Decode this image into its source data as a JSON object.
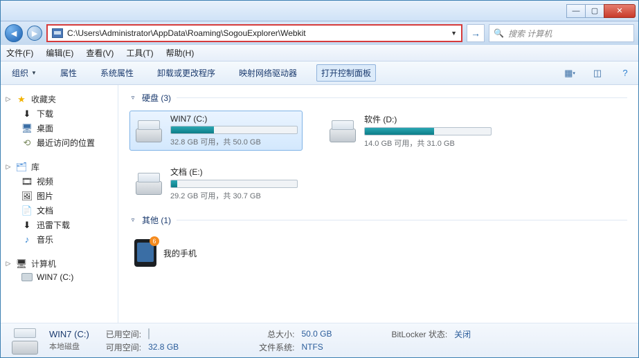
{
  "address_bar": {
    "path": "C:\\Users\\Administrator\\AppData\\Roaming\\SogouExplorer\\Webkit"
  },
  "search": {
    "placeholder": "搜索 计算机"
  },
  "menu": {
    "file": "文件(F)",
    "edit": "编辑(E)",
    "view": "查看(V)",
    "tools": "工具(T)",
    "help": "帮助(H)"
  },
  "toolbar": {
    "organize": "组织",
    "properties": "属性",
    "sysProperties": "系统属性",
    "uninstall": "卸载或更改程序",
    "mapDrive": "映射网络驱动器",
    "controlPanel": "打开控制面板"
  },
  "sidebar": {
    "favorites": {
      "label": "收藏夹",
      "items": [
        {
          "label": "下载"
        },
        {
          "label": "桌面"
        },
        {
          "label": "最近访问的位置"
        }
      ]
    },
    "libraries": {
      "label": "库",
      "items": [
        {
          "label": "视频"
        },
        {
          "label": "图片"
        },
        {
          "label": "文档"
        },
        {
          "label": "迅雷下载"
        },
        {
          "label": "音乐"
        }
      ]
    },
    "computer": {
      "label": "计算机",
      "items": [
        {
          "label": "WIN7 (C:)"
        }
      ]
    }
  },
  "sections": {
    "hdd": {
      "label": "硬盘 (3)"
    },
    "other": {
      "label": "其他 (1)"
    }
  },
  "drives": [
    {
      "name": "WIN7 (C:)",
      "free": "32.8 GB 可用，共 50.0 GB",
      "pct": 34,
      "selected": true
    },
    {
      "name": "软件 (D:)",
      "free": "14.0 GB 可用，共 31.0 GB",
      "pct": 55,
      "selected": false
    },
    {
      "name": "文档 (E:)",
      "free": "29.2 GB 可用，共 30.7 GB",
      "pct": 5,
      "selected": false
    }
  ],
  "other_items": [
    {
      "name": "我的手机",
      "badge": "6"
    }
  ],
  "details": {
    "title": "WIN7 (C:)",
    "subtitle": "本地磁盘",
    "usedLabel": "已用空间:",
    "availLabel": "可用空间:",
    "availVal": "32.8 GB",
    "totalLabel": "总大小:",
    "totalVal": "50.0 GB",
    "fsLabel": "文件系统:",
    "fsVal": "NTFS",
    "bitlockerLabel": "BitLocker 状态:",
    "bitlockerVal": "关闭"
  }
}
